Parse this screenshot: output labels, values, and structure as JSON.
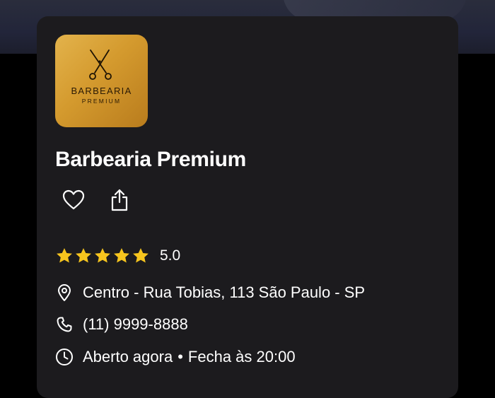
{
  "business": {
    "logo": {
      "title": "BARBEARIA",
      "subtitle": "PREMIUM",
      "icon": "scissors-icon",
      "colors": [
        "#e3b34c",
        "#b97c1d"
      ]
    },
    "name": "Barbearia Premium",
    "actions": {
      "favorite_icon": "heart-icon",
      "share_icon": "share-icon"
    },
    "rating": {
      "stars": 5,
      "value": "5.0",
      "star_color": "#f7c51e"
    },
    "address": "Centro - Rua Tobias, 113 São Paulo - SP",
    "phone": "(11) 9999-8888",
    "hours": {
      "status": "Aberto agora",
      "separator": "•",
      "closing": "Fecha às 20:00"
    }
  }
}
